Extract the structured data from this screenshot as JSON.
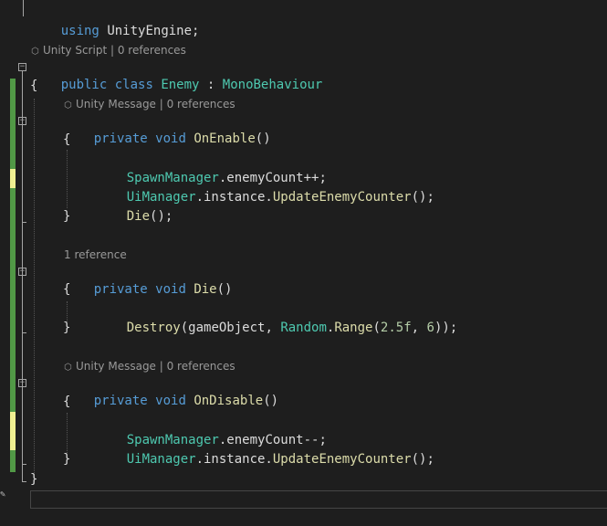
{
  "code": {
    "using_kw": "using",
    "using_ns": "UnityEngine;",
    "lens_class": "Unity Script | 0 references",
    "class_line": {
      "public": "public",
      "class": "class",
      "name": "Enemy",
      "colon": " : ",
      "base": "MonoBehaviour"
    },
    "brace_open": "{",
    "brace_close": "}",
    "lens_onenable": "Unity Message | 0 references",
    "onenable": {
      "private": "private",
      "void": "void",
      "name": "OnEnable",
      "parens": "()"
    },
    "onenable_body": [
      {
        "a": "SpawnManager",
        "b": ".enemyCount++;"
      },
      {
        "a": "UiManager",
        "b": ".instance.",
        "c": "UpdateEnemyCounter",
        "d": "();"
      },
      {
        "c": "Die",
        "d": "();"
      }
    ],
    "lens_die": "1 reference",
    "die": {
      "private": "private",
      "void": "void",
      "name": "Die",
      "parens": "()"
    },
    "die_body": {
      "destroy": "Destroy",
      "args1": "(gameObject, ",
      "random": "Random",
      "dot": ".",
      "range": "Range",
      "open": "(",
      "n1": "2.5f",
      "comma": ", ",
      "n2": "6",
      "close": "));"
    },
    "lens_ondisable": "Unity Message | 0 references",
    "ondisable": {
      "private": "private",
      "void": "void",
      "name": "OnDisable",
      "parens": "()"
    },
    "ondisable_body": [
      {
        "a": "SpawnManager",
        "b": ".enemyCount--;"
      },
      {
        "a": "UiManager",
        "b": ".instance.",
        "c": "UpdateEnemyCounter",
        "d": "();"
      }
    ]
  },
  "colors": {
    "background": "#1e1e1e",
    "keyword": "#569cd6",
    "type": "#4ec9b0",
    "method": "#dcdcaa",
    "number": "#b5cea8",
    "text": "#dcdcdc",
    "lens": "#999999",
    "change_saved": "#57a64a",
    "change_unsaved": "#efef91"
  },
  "icons": {
    "lens_icon": "cube-icon",
    "fold_icon": "collapse-minus-icon"
  }
}
